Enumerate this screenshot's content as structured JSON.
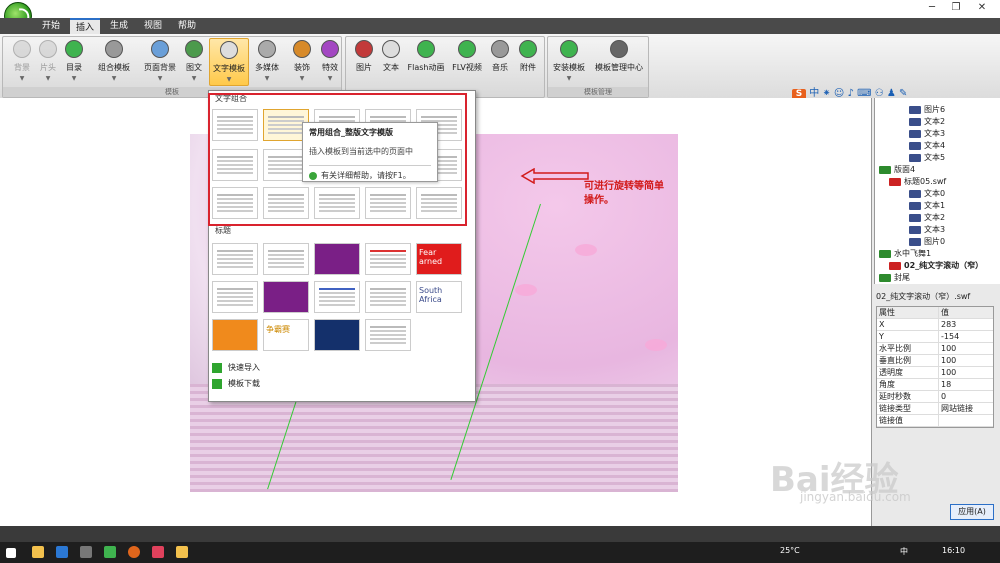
{
  "menubar": {
    "items": [
      "开始",
      "插入",
      "生成",
      "视图",
      "帮助"
    ],
    "active": "插入"
  },
  "ribbon": {
    "buttons": [
      {
        "label": "背景",
        "disabled": true
      },
      {
        "label": "片头",
        "disabled": true
      },
      {
        "label": "目录"
      },
      {
        "label": "组合模板"
      },
      {
        "label": "页面背景"
      },
      {
        "label": "图文"
      },
      {
        "label": "文字模板",
        "active": true
      },
      {
        "label": "多媒体"
      },
      {
        "label": "装饰"
      },
      {
        "label": "特效"
      },
      {
        "label": "图片"
      },
      {
        "label": "文本"
      },
      {
        "label": "Flash动画"
      },
      {
        "label": "FLV视频"
      },
      {
        "label": "音乐"
      },
      {
        "label": "附件"
      },
      {
        "label": "安装模板"
      },
      {
        "label": "模板管理中心"
      }
    ],
    "groups": [
      "模板",
      "模板管理"
    ]
  },
  "ime": {
    "logo": "S",
    "lang": "中"
  },
  "popup": {
    "section1": "文字组合",
    "section2": "标题",
    "footer1": "快速导入",
    "footer2": "模板下载",
    "title_thumbs": [
      "Fear arned",
      "South Africa",
      "争霸赛"
    ]
  },
  "tooltip": {
    "title": "常用组合_整版文字模版",
    "desc": "插入模板到当前选中的页面中",
    "help": "有关详细帮助，请按F1。"
  },
  "annotation": "可进行旋转等简单操作。",
  "tree": {
    "nodes": [
      {
        "label": "图片6",
        "type": "b"
      },
      {
        "label": "文本2",
        "type": "b"
      },
      {
        "label": "文本3",
        "type": "b"
      },
      {
        "label": "文本4",
        "type": "b"
      },
      {
        "label": "文本5",
        "type": "b"
      },
      {
        "label": "版面4",
        "type": "g"
      },
      {
        "label": "标题05.swf",
        "type": "r"
      },
      {
        "label": "文本0",
        "type": "b"
      },
      {
        "label": "文本1",
        "type": "b"
      },
      {
        "label": "文本2",
        "type": "b"
      },
      {
        "label": "文本3",
        "type": "b"
      },
      {
        "label": "图片0",
        "type": "b"
      },
      {
        "label": "水中飞舞1",
        "type": "g"
      },
      {
        "label": "02_纯文字滚动（窄）",
        "type": "r"
      },
      {
        "label": "封尾",
        "type": "g"
      }
    ]
  },
  "properties": {
    "title": "02_纯文字滚动（窄）.swf",
    "header": [
      "属性",
      "值"
    ],
    "rows": [
      [
        "X",
        "283"
      ],
      [
        "Y",
        "-154"
      ],
      [
        "水平比例",
        "100"
      ],
      [
        "垂直比例",
        "100"
      ],
      [
        "透明度",
        "100"
      ],
      [
        "角度",
        "18"
      ],
      [
        "延时秒数",
        "0"
      ],
      [
        "链接类型",
        "网站链接"
      ],
      [
        "链接值",
        ""
      ]
    ]
  },
  "apply_label": "应用(A)",
  "taskbar": {
    "weather": "25°C",
    "ime": "中",
    "time": "16:10"
  },
  "watermark": {
    "text": "Bai经验",
    "url": "jingyan.baidu.com"
  }
}
